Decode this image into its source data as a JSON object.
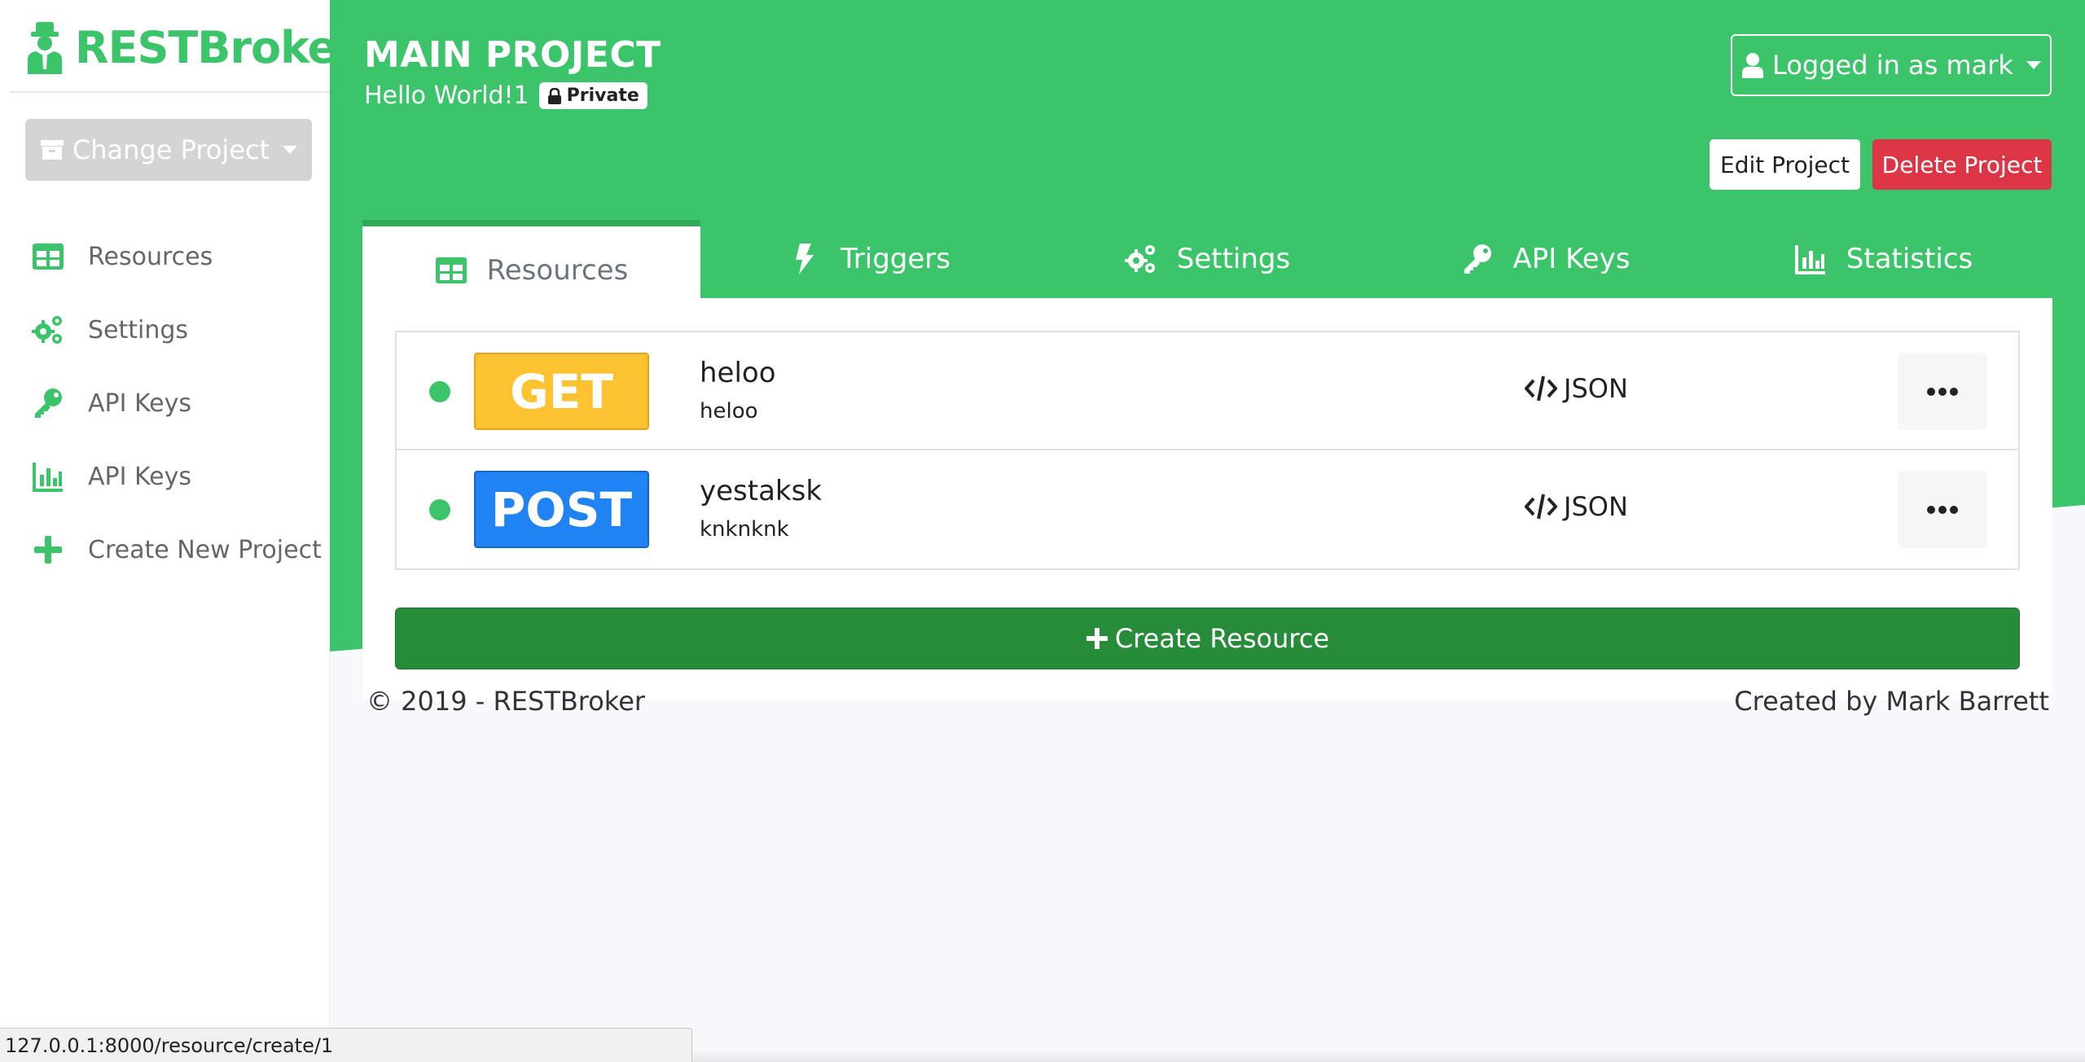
{
  "app": {
    "brand": "RESTBroker"
  },
  "sidebar": {
    "change_project_label": "Change Project",
    "items": [
      {
        "label": "Resources",
        "icon": "table-icon"
      },
      {
        "label": "Settings",
        "icon": "gears-icon"
      },
      {
        "label": "API Keys",
        "icon": "key-icon"
      },
      {
        "label": "API Keys",
        "icon": "bar-chart-icon"
      },
      {
        "label": "Create New Project",
        "icon": "plus-icon"
      }
    ]
  },
  "project": {
    "title": "MAIN PROJECT",
    "subtitle": "Hello World!1",
    "visibility": "Private"
  },
  "header": {
    "user_label": "Logged in as mark",
    "edit_label": "Edit Project",
    "delete_label": "Delete Project"
  },
  "tabs": [
    {
      "label": "Resources",
      "icon": "table-icon",
      "active": true
    },
    {
      "label": "Triggers",
      "icon": "bolt-icon",
      "active": false
    },
    {
      "label": "Settings",
      "icon": "gears-icon",
      "active": false
    },
    {
      "label": "API Keys",
      "icon": "key-icon",
      "active": false
    },
    {
      "label": "Statistics",
      "icon": "bar-chart-icon",
      "active": false
    }
  ],
  "resources": [
    {
      "method": "GET",
      "name": "heloo",
      "description": "heloo",
      "format": "JSON",
      "status": "active"
    },
    {
      "method": "POST",
      "name": "yestaksk",
      "description": "knknknk",
      "format": "JSON",
      "status": "active"
    }
  ],
  "create_resource_label": "Create Resource",
  "footer": {
    "left": "© 2019 - RESTBroker",
    "right": "Created by Mark Barrett"
  },
  "status_bar": {
    "url": "127.0.0.1:8000/resource/create/1"
  },
  "colors": {
    "brand_green": "#3cc46a",
    "dark_green": "#268c39",
    "danger": "#dc3545",
    "get": "#fcc22f",
    "post": "#1f83f4"
  }
}
